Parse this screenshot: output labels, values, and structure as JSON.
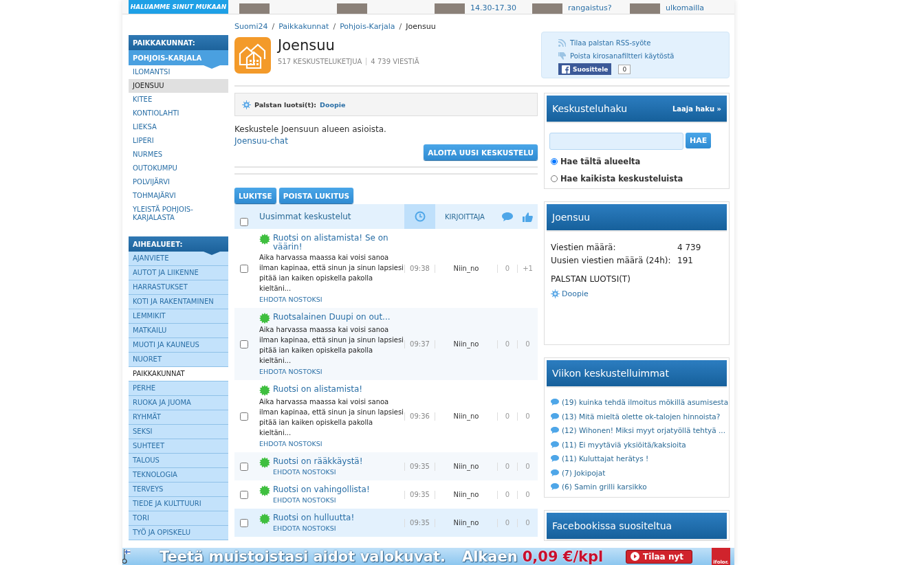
{
  "top_strip": {
    "banner": "HALUAMME SINUT MUKAAN",
    "teasers": [
      {
        "kind": "photo"
      },
      {
        "kind": "photo"
      },
      {
        "kind": "photo_text",
        "text": "14.30-17.30"
      },
      {
        "kind": "photo_text",
        "text": "rangaistus?"
      },
      {
        "kind": "photo_text",
        "text": "ulkomailla"
      }
    ]
  },
  "sidebar": {
    "sections": [
      {
        "title": "PAIKKAKUNNAT:",
        "subtitle": "POHJOIS-KARJALA",
        "items": [
          {
            "label": "ILOMANTSI",
            "selected": false
          },
          {
            "label": "JOENSUU",
            "selected": true
          },
          {
            "label": "KITEE",
            "selected": false
          },
          {
            "label": "KONTIOLAHTI",
            "selected": false
          },
          {
            "label": "LIEKSA",
            "selected": false
          },
          {
            "label": "LIPERI",
            "selected": false
          },
          {
            "label": "NURMES",
            "selected": false
          },
          {
            "label": "OUTOKUMPU",
            "selected": false
          },
          {
            "label": "POLVIJÄRVI",
            "selected": false
          },
          {
            "label": "TOHMAJÄRVI",
            "selected": false
          },
          {
            "label": "YLEISTÄ POHJOIS-KARJALASTA",
            "selected": false
          }
        ]
      },
      {
        "title": "AIHEALUEET:",
        "items": [
          {
            "label": "AJANVIETE",
            "selected": false
          },
          {
            "label": "AUTOT JA LIIKENNE",
            "selected": false
          },
          {
            "label": "HARRASTUKSET",
            "selected": false
          },
          {
            "label": "KOTI JA RAKENTAMINEN",
            "selected": false
          },
          {
            "label": "LEMMIKIT",
            "selected": false
          },
          {
            "label": "MATKAILU",
            "selected": false
          },
          {
            "label": "MUOTI JA KAUNEUS",
            "selected": false
          },
          {
            "label": "NUORET",
            "selected": false
          },
          {
            "label": "PAIKKAKUNNAT",
            "selected": true
          },
          {
            "label": "PERHE",
            "selected": false
          },
          {
            "label": "RUOKA JA JUOMA",
            "selected": false
          },
          {
            "label": "RYHMÄT",
            "selected": false
          },
          {
            "label": "SEKSI",
            "selected": false
          },
          {
            "label": "SUHTEET",
            "selected": false
          },
          {
            "label": "TALOUS",
            "selected": false
          },
          {
            "label": "TEKNOLOGIA",
            "selected": false
          },
          {
            "label": "TERVEYS",
            "selected": false
          },
          {
            "label": "TIEDE JA KULTTUURI",
            "selected": false
          },
          {
            "label": "TORI",
            "selected": false
          },
          {
            "label": "TYÖ JA OPISKELU",
            "selected": false
          }
        ]
      }
    ]
  },
  "breadcrumb": [
    "Suomi24",
    "Paikkakunnat",
    "Pohjois-Karjala",
    "Joensuu"
  ],
  "breadcrumb_separator": "/",
  "forum": {
    "title": "Joensuu",
    "threads_count": "517 KESKUSTELUKETJUA",
    "messages_count": "4 739 VIESTIÄ"
  },
  "actions": {
    "rss": "Tilaa palstan RSS-syöte",
    "filter": "Poista kirosanafiltteri käytöstä",
    "like": "Suosittele",
    "like_count": "0"
  },
  "moderator": {
    "label": "Palstan luotsi(t):",
    "name": "Doopie"
  },
  "description": "Keskustele Joensuun alueen asioista.",
  "chat_link": "Joensuu-chat",
  "new_thread_button": "ALOITA UUSI KESKUSTELU",
  "bulk_buttons": [
    "LUKITSE",
    "POISTA LUKITUS"
  ],
  "table": {
    "title": "Uusimmat keskustelut",
    "author_column": "KIRJOITTAJA",
    "select_all_checked": false,
    "rows": [
      {
        "title": "Ruotsi on alistamista! Se on väärin!",
        "excerpt": "Aika harvassa maassa kai voisi sanoa ilman kapinaa, että sinun ja sinun lapsiesi pitää ian kaiken opiskella pakolla kieltäni...",
        "suggest": "EHDOTA NOSTOKSI",
        "time": "09:38",
        "author": "Niin_no",
        "replies": "0",
        "likes": "+1",
        "checked": false,
        "highlighted": false
      },
      {
        "title": "Ruotsalainen Duupi on out...",
        "excerpt": "Aika harvassa maassa kai voisi sanoa ilman kapinaa, että sinun ja sinun lapsiesi pitää ian kaiken opiskella pakolla kieltäni...",
        "suggest": "EHDOTA NOSTOKSI",
        "time": "09:37",
        "author": "Niin_no",
        "replies": "0",
        "likes": "0",
        "checked": false,
        "highlighted": false
      },
      {
        "title": "Ruotsi on alistamista!",
        "excerpt": "Aika harvassa maassa kai voisi sanoa ilman kapinaa, että sinun ja sinun lapsiesi pitää ian kaiken opiskella pakolla kieltäni...",
        "suggest": "EHDOTA NOSTOKSI",
        "time": "09:36",
        "author": "Niin_no",
        "replies": "0",
        "likes": "0",
        "checked": false,
        "highlighted": false
      },
      {
        "title": "Ruotsi on rääkkäystä!",
        "suggest": "EHDOTA NOSTOKSI",
        "time": "09:35",
        "author": "Niin_no",
        "replies": "0",
        "likes": "0",
        "checked": false,
        "highlighted": false
      },
      {
        "title": "Ruotsi on vahingollista!",
        "suggest": "EHDOTA NOSTOKSI",
        "time": "09:35",
        "author": "Niin_no",
        "replies": "0",
        "likes": "0",
        "checked": false,
        "highlighted": false
      },
      {
        "title": "Ruotsi on hulluutta!",
        "suggest": "EHDOTA NOSTOKSI",
        "time": "09:35",
        "author": "Niin_no",
        "replies": "0",
        "likes": "0",
        "checked": false,
        "highlighted": true
      }
    ]
  },
  "search": {
    "title": "Keskusteluhaku",
    "advanced_link": "Laaja haku »",
    "button": "HAE",
    "options": [
      {
        "label": "Hae tältä alueelta",
        "selected": true
      },
      {
        "label": "Hae kaikista keskusteluista",
        "selected": false
      }
    ]
  },
  "stats": {
    "title": "Joensuu",
    "rows": [
      {
        "label": "Viestien määrä:",
        "value": "4 739"
      },
      {
        "label": "Uusien viestien määrä (24h):",
        "value": "191"
      }
    ],
    "moderators_heading": "PALSTAN LUOTSI(T)",
    "moderator": "Doopie"
  },
  "weekly": {
    "title": "Viikon keskustelluimmat",
    "items": [
      "(19) kuinka tehdä ilmoitus mökillä asumisesta",
      "(13) Mitä mieltä olette ok-talojen hinnoista?",
      "(12) Wihonen! Miksi myyt orjatyöllä tehtyä ...",
      "(11) Ei myytäviä yksiöitä/kaksioita",
      "(11) Kuluttajat herätys !",
      "(7) Jokipojat",
      "(6) Samin grilli karsikko"
    ]
  },
  "facebook": {
    "title": "Facebookissa suositeltua"
  },
  "ad": {
    "headline": "Teetä muistoistasi aidot valokuvat.",
    "price_prefix": "Alkaen",
    "price": "0,09 €/kpl",
    "button": "Tilaa nyt",
    "logo": "ifolor."
  }
}
